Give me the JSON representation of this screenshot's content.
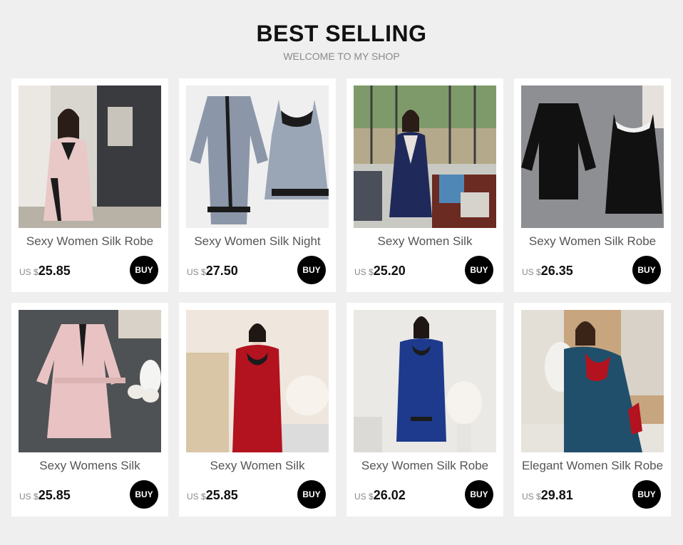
{
  "header": {
    "title": "BEST SELLING",
    "subtitle": "WELCOME TO MY SHOP"
  },
  "buy_label": "BUY",
  "currency": "US $",
  "products": [
    {
      "name": "Sexy Women Silk Robe",
      "price": "25.85",
      "icon": "pink-robe-model-photo",
      "color": "#e8c9c8"
    },
    {
      "name": "Sexy Women Silk Night",
      "price": "27.50",
      "icon": "grey-robe-set-photo",
      "color": "#8b96a8"
    },
    {
      "name": "Sexy Women Silk",
      "price": "25.20",
      "icon": "navy-robe-model-photo",
      "color": "#1f2a5a"
    },
    {
      "name": "Sexy Women Silk Robe",
      "price": "26.35",
      "icon": "black-robe-set-photo",
      "color": "#111111"
    },
    {
      "name": "Sexy Womens Silk",
      "price": "25.85",
      "icon": "pink-robe-flatlay-photo",
      "color": "#e9c3c3"
    },
    {
      "name": "Sexy Women Silk",
      "price": "25.85",
      "icon": "red-robe-model-photo",
      "color": "#b3121f"
    },
    {
      "name": "Sexy Women Silk Robe",
      "price": "26.02",
      "icon": "blue-robe-model-photo",
      "color": "#1d3a8c"
    },
    {
      "name": "Elegant Women Silk Robe",
      "price": "29.81",
      "icon": "teal-red-robe-model-photo",
      "color": "#1f4f6b"
    }
  ]
}
